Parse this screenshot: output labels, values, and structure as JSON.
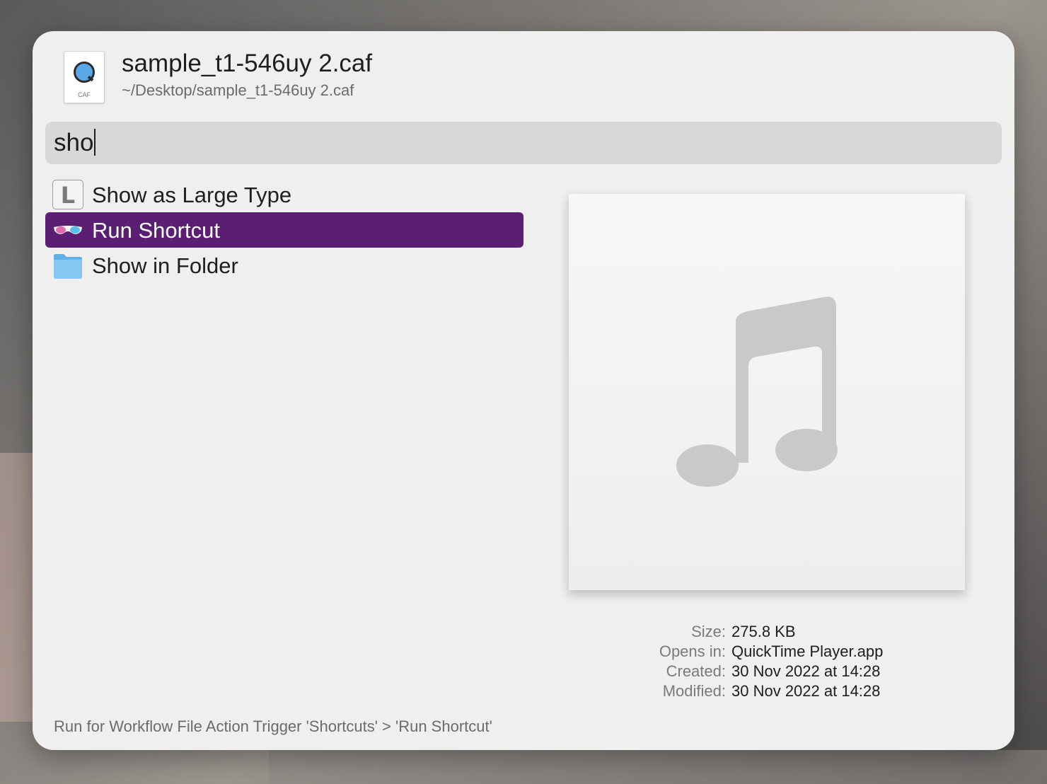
{
  "header": {
    "icon_name": "caf-file-icon",
    "icon_ext": "CAF",
    "title": "sample_t1-546uy 2.caf",
    "path": "~/Desktop/sample_t1-546uy 2.caf"
  },
  "search": {
    "value": "sho"
  },
  "results": [
    {
      "label": "Show as Large Type",
      "icon": "large-type-icon",
      "selected": false
    },
    {
      "label": "Run Shortcut",
      "icon": "shortcuts-glasses-icon",
      "selected": true
    },
    {
      "label": "Show in Folder",
      "icon": "folder-icon",
      "selected": false
    }
  ],
  "preview": {
    "icon": "music-note-icon"
  },
  "meta": {
    "size_label": "Size:",
    "size_value": "275.8 KB",
    "opens_label": "Opens in:",
    "opens_value": "QuickTime Player.app",
    "created_label": "Created:",
    "created_value": "30 Nov 2022 at 14:28",
    "modified_label": "Modified:",
    "modified_value": "30 Nov 2022 at 14:28"
  },
  "status_text": "Run for Workflow File Action Trigger 'Shortcuts' > 'Run Shortcut'",
  "colors": {
    "selection": "#5a1f73",
    "panel": "#efefef",
    "search_bg": "#d8d8d8"
  }
}
